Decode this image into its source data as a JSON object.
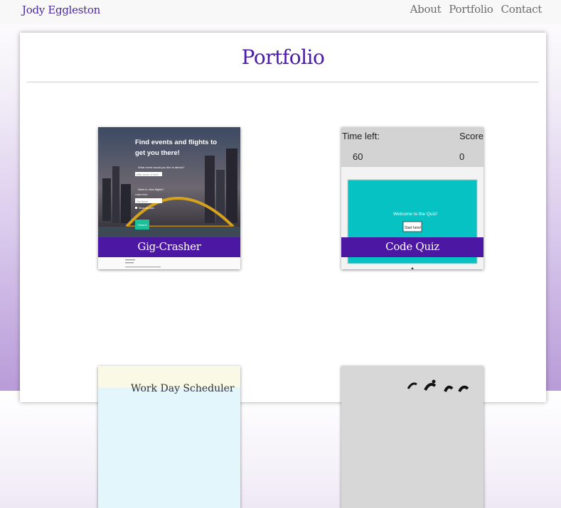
{
  "nav": {
    "brand": "Jody Eggleston",
    "links": [
      "About",
      "Portfolio",
      "Contact"
    ]
  },
  "page": {
    "title": "Portfolio"
  },
  "projects": [
    {
      "caption": "Gig-Crasher",
      "screenshot_text": {
        "heading_line1": "Find events and flights to",
        "heading_line2": "get you there!",
        "question": "What event would you like to attend?",
        "input_hint": "artist, venue, or event",
        "flights": "Want to view flights?",
        "city_label": "Leave from:",
        "city_hint": "City Name",
        "checkbox": "Show all posts",
        "button": "Search"
      }
    },
    {
      "caption": "Code Quiz",
      "screenshot_text": {
        "time_label": "Time left:",
        "time_value": "60",
        "score_label": "Score:",
        "score_value": "0",
        "welcome": "Welcome to the Quiz!",
        "start": "Start here!"
      }
    },
    {
      "caption": "",
      "screenshot_text": {
        "heading": "Work Day Scheduler"
      }
    },
    {
      "caption": "",
      "screenshot_text": {}
    }
  ],
  "colors": {
    "brand": "#4b2a9e",
    "title": "#4b1aa8",
    "caption_bg": "#4c17a3",
    "quiz_teal": "#06c2c2"
  }
}
